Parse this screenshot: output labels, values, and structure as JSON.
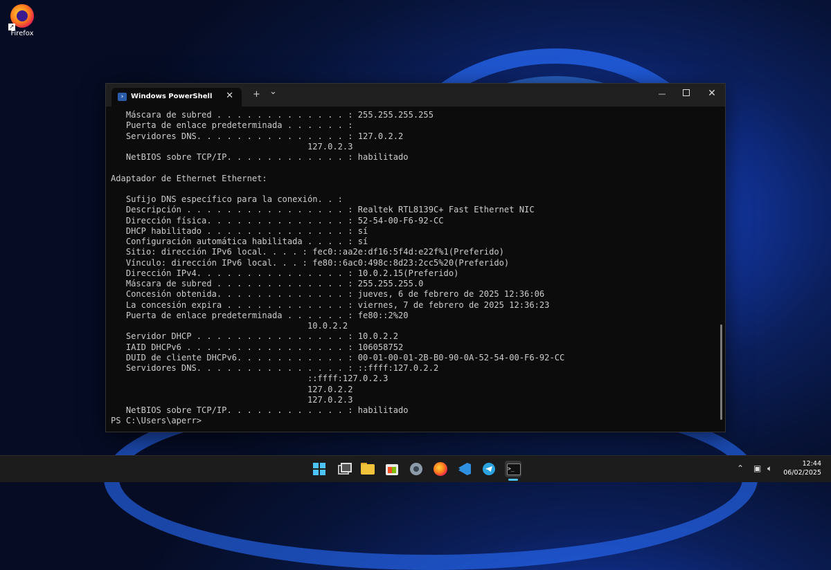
{
  "desktop": {
    "icons": [
      {
        "label": "Firefox",
        "icon": "firefox-icon"
      }
    ]
  },
  "window": {
    "tab_title": "Windows PowerShell",
    "tab_icon": "powershell-icon",
    "new_tab_glyph": "+",
    "dropdown_glyph": "⌄",
    "minimize_glyph": "—",
    "close_glyph": "✕",
    "tab_close_glyph": "✕"
  },
  "terminal": {
    "lines": [
      "   Máscara de subred . . . . . . . . . . . . . : 255.255.255.255",
      "   Puerta de enlace predeterminada . . . . . . :",
      "   Servidores DNS. . . . . . . . . . . . . . . : 127.0.2.2",
      "                                       127.0.2.3",
      "   NetBIOS sobre TCP/IP. . . . . . . . . . . . : habilitado",
      "",
      "Adaptador de Ethernet Ethernet:",
      "",
      "   Sufijo DNS específico para la conexión. . :",
      "   Descripción . . . . . . . . . . . . . . . . : Realtek RTL8139C+ Fast Ethernet NIC",
      "   Dirección física. . . . . . . . . . . . . . : 52-54-00-F6-92-CC",
      "   DHCP habilitado . . . . . . . . . . . . . . : sí",
      "   Configuración automática habilitada . . . . : sí",
      "   Sitio: dirección IPv6 local. . . . : fec0::aa2e:df16:5f4d:e22f%1(Preferido)",
      "   Vínculo: dirección IPv6 local. . . : fe80::6ac0:498c:8d23:2cc5%20(Preferido)",
      "   Dirección IPv4. . . . . . . . . . . . . . . : 10.0.2.15(Preferido)",
      "   Máscara de subred . . . . . . . . . . . . . : 255.255.255.0",
      "   Concesión obtenida. . . . . . . . . . . . . : jueves, 6 de febrero de 2025 12:36:06",
      "   La concesión expira . . . . . . . . . . . . : viernes, 7 de febrero de 2025 12:36:23",
      "   Puerta de enlace predeterminada . . . . . . : fe80::2%20",
      "                                       10.0.2.2",
      "   Servidor DHCP . . . . . . . . . . . . . . . : 10.0.2.2",
      "   IAID DHCPv6 . . . . . . . . . . . . . . . . : 106058752",
      "   DUID de cliente DHCPv6. . . . . . . . . . . : 00-01-00-01-2B-B0-90-0A-52-54-00-F6-92-CC",
      "   Servidores DNS. . . . . . . . . . . . . . . : ::ffff:127.0.2.2",
      "                                       ::ffff:127.0.2.3",
      "                                       127.0.2.2",
      "                                       127.0.2.3",
      "   NetBIOS sobre TCP/IP. . . . . . . . . . . . : habilitado",
      "PS C:\\Users\\aperr>"
    ]
  },
  "taskbar": {
    "apps": [
      "start-icon",
      "task-view-icon",
      "file-explorer-icon",
      "store-icon",
      "settings-icon",
      "firefox-icon",
      "vscode-icon",
      "telegram-icon",
      "terminal-icon"
    ],
    "terminal_glyph": ">_",
    "tray": {
      "chevron": "⌃",
      "network_icon": "network-icon",
      "volume_icon": "volume-icon"
    },
    "time": "12:44",
    "date": "06/02/2025"
  },
  "colors": {
    "terminal_bg": "#0c0c0c",
    "terminal_fg": "#cccccc",
    "titlebar_bg": "#202020",
    "taskbar_bg": "#1c1c1c",
    "accent": "#4cc2ff"
  }
}
